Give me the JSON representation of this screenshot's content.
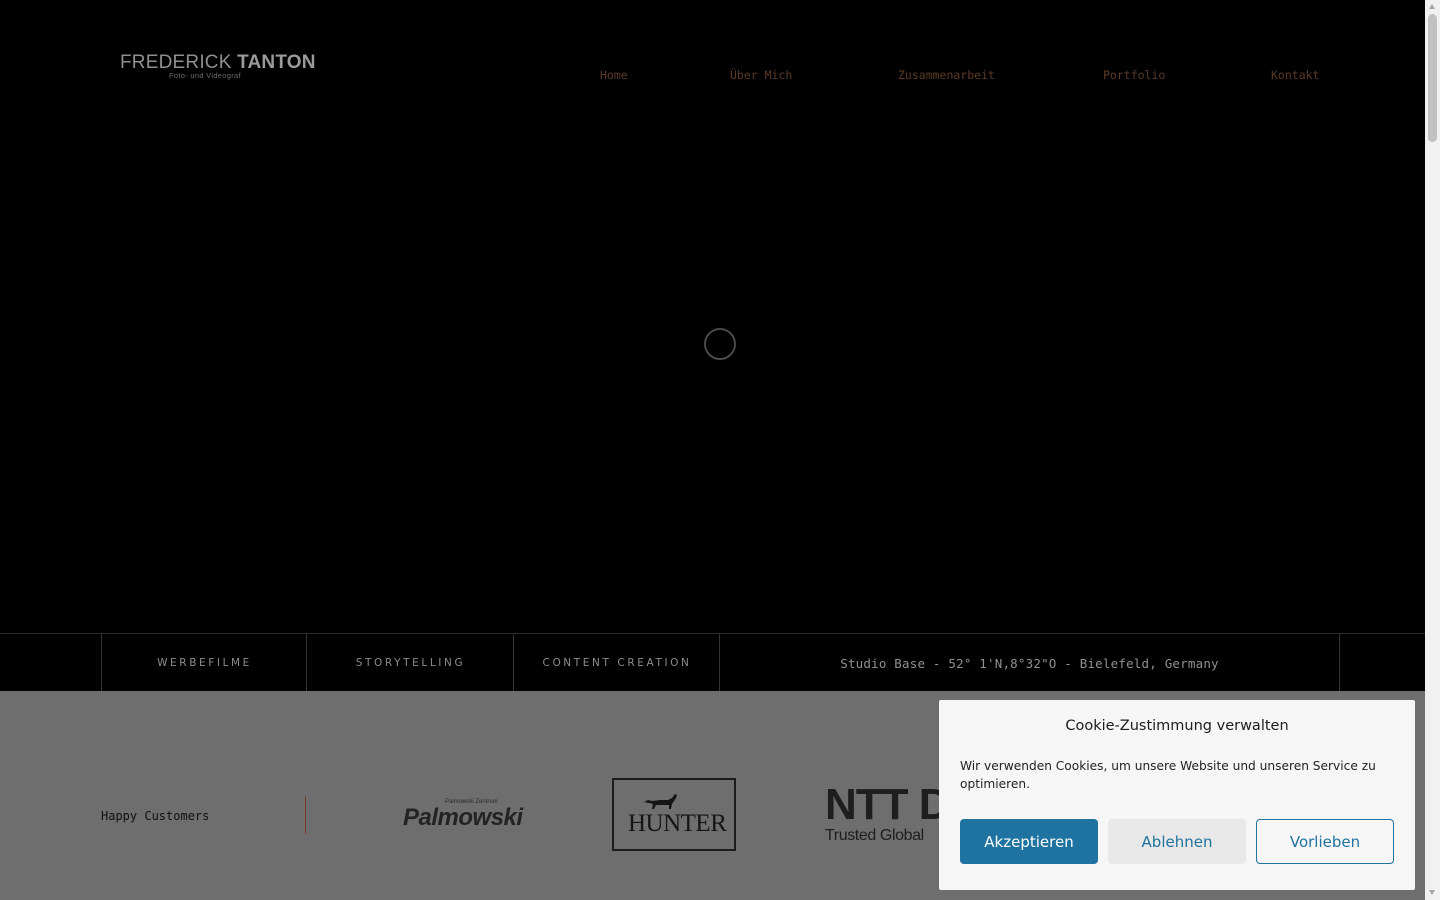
{
  "header": {
    "logo": {
      "first": "FREDERICK",
      "last": "TANTON",
      "tagline": "Foto- und Videograf"
    },
    "nav": [
      {
        "label": "Home"
      },
      {
        "label": "Über Mich"
      },
      {
        "label": "Zusammenarbeit"
      },
      {
        "label": "Portfolio"
      },
      {
        "label": "Kontakt"
      }
    ]
  },
  "strip": {
    "services": [
      "WERBEFILME",
      "STORYTELLING",
      "CONTENT CREATION"
    ],
    "studio": "Studio Base - 52° 1'N,8°32\"O - Bielefeld, Germany"
  },
  "customers": {
    "label": "Happy Customers",
    "logos": {
      "palmowski_small": "Palmowski Zentrum",
      "palmowski": "Palmowski",
      "hunter": "HUNTER",
      "ntt": "NTT D",
      "ntt_sub": "Trusted Global"
    }
  },
  "cookie": {
    "title": "Cookie-Zustimmung verwalten",
    "text": "Wir verwenden Cookies, um unsere Website und unseren Service zu optimieren.",
    "accept": "Akzeptieren",
    "deny": "Ablehnen",
    "prefs": "Vorlieben"
  },
  "colors": {
    "background": "#000000",
    "nav_text": "#5b3a26",
    "customers_band": "#6e6e6e",
    "accent_blue": "#1e73a0"
  }
}
